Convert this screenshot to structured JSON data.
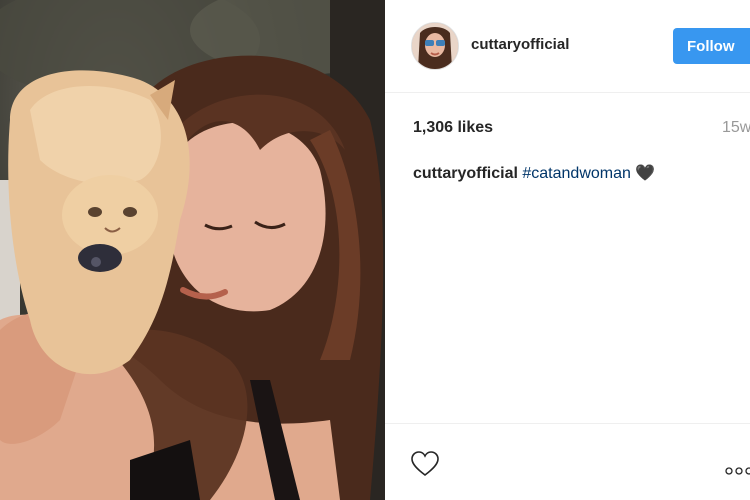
{
  "post": {
    "username": "cuttaryofficial",
    "follow_label": "Follow",
    "likes": "1,306 likes",
    "time": "15w",
    "caption": {
      "username": "cuttaryofficial",
      "hashtag": "#catandwoman",
      "emoji": "🖤"
    }
  },
  "icons": {
    "like": "heart-outline-icon",
    "more": "more-options-icon"
  },
  "colors": {
    "follow_button": "#3897f0",
    "hashtag": "#003569",
    "muted": "#999999",
    "divider": "#efefef"
  }
}
